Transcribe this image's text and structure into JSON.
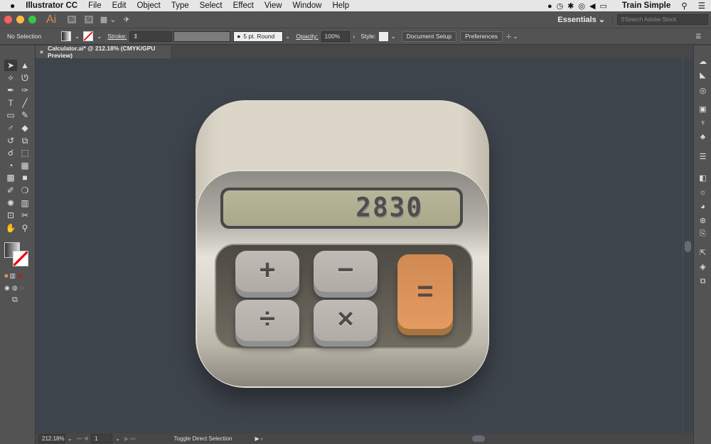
{
  "menubar": {
    "apple": "",
    "app": "Illustrator CC",
    "items": [
      "File",
      "Edit",
      "Object",
      "Type",
      "Select",
      "Effect",
      "View",
      "Window",
      "Help"
    ],
    "user": "Train Simple"
  },
  "appbar": {
    "logo": "Ai",
    "bridge": "Br",
    "stock": "St",
    "workspace": "Essentials",
    "search_placeholder": "Search Adobe Stock"
  },
  "control": {
    "selection": "No Selection",
    "stroke_label": "Stroke:",
    "brush": "5 pt. Round",
    "opacity_label": "Opacity:",
    "opacity": "100%",
    "style_label": "Style:",
    "doc_setup": "Document Setup",
    "preferences": "Preferences"
  },
  "tab": {
    "close": "×",
    "title": "Calculator.ai* @ 212.18% (CMYK/GPU Preview)"
  },
  "status": {
    "zoom": "212.18%",
    "page": "1",
    "message": "Toggle Direct Selection"
  },
  "artwork": {
    "display": "2830",
    "keys": {
      "plus": "+",
      "minus": "−",
      "divide": "÷",
      "times": "×",
      "equals": "="
    },
    "colors": {
      "body": "#dcd6c8",
      "lcd": "#b0af92",
      "equals": "#e0955c",
      "key": "#b8b3ad"
    }
  },
  "tools": [
    {
      "icon": "selection-icon",
      "g": "➤"
    },
    {
      "icon": "direct-selection-icon",
      "g": "▲"
    },
    {
      "icon": "magic-wand-icon",
      "g": "✧"
    },
    {
      "icon": "lasso-icon",
      "g": "ᘎ"
    },
    {
      "icon": "pen-icon",
      "g": "✒"
    },
    {
      "icon": "curvature-icon",
      "g": "✑"
    },
    {
      "icon": "type-icon",
      "g": "T"
    },
    {
      "icon": "line-icon",
      "g": "╱"
    },
    {
      "icon": "rectangle-icon",
      "g": "▭"
    },
    {
      "icon": "paintbrush-icon",
      "g": "✎"
    },
    {
      "icon": "shaper-icon",
      "g": "♂"
    },
    {
      "icon": "eraser-icon",
      "g": "◆"
    },
    {
      "icon": "rotate-icon",
      "g": "↺"
    },
    {
      "icon": "scale-icon",
      "g": "⧉"
    },
    {
      "icon": "warp-icon",
      "g": "☌"
    },
    {
      "icon": "free-transform-icon",
      "g": "⬚"
    },
    {
      "icon": "shape-builder-icon",
      "g": "◔"
    },
    {
      "icon": "perspective-icon",
      "g": "▦"
    },
    {
      "icon": "mesh-icon",
      "g": "▩"
    },
    {
      "icon": "gradient-icon",
      "g": "■"
    },
    {
      "icon": "eyedropper-icon",
      "g": "✐"
    },
    {
      "icon": "blend-icon",
      "g": "❍"
    },
    {
      "icon": "symbol-sprayer-icon",
      "g": "✺"
    },
    {
      "icon": "graph-icon",
      "g": "▥"
    },
    {
      "icon": "artboard-icon",
      "g": "⊡"
    },
    {
      "icon": "slice-icon",
      "g": "✂"
    },
    {
      "icon": "hand-icon",
      "g": "✋"
    },
    {
      "icon": "zoom-icon",
      "g": "⚲"
    }
  ],
  "panels": [
    {
      "icon": "color-icon",
      "g": "☁"
    },
    {
      "icon": "color-guide-icon",
      "g": "◣"
    },
    {
      "icon": "appearance-icon",
      "g": "◎"
    },
    {
      "icon": "image-trace-icon",
      "g": "▣"
    },
    {
      "icon": "brushes-icon",
      "g": "♆"
    },
    {
      "icon": "symbols-icon",
      "g": "♣"
    },
    {
      "icon": "stroke-icon",
      "g": "☰"
    },
    {
      "icon": "gradient-panel-icon",
      "g": "◧"
    },
    {
      "icon": "transparency-icon",
      "g": "☼"
    },
    {
      "icon": "graphic-styles-icon",
      "g": "◕"
    },
    {
      "icon": "cc-libraries-icon",
      "g": "⊛"
    },
    {
      "icon": "asset-export-icon",
      "g": "⎘"
    },
    {
      "icon": "export-icon",
      "g": "⇱"
    },
    {
      "icon": "layers-icon",
      "g": "◈"
    },
    {
      "icon": "artboards-icon",
      "g": "⧉"
    }
  ]
}
